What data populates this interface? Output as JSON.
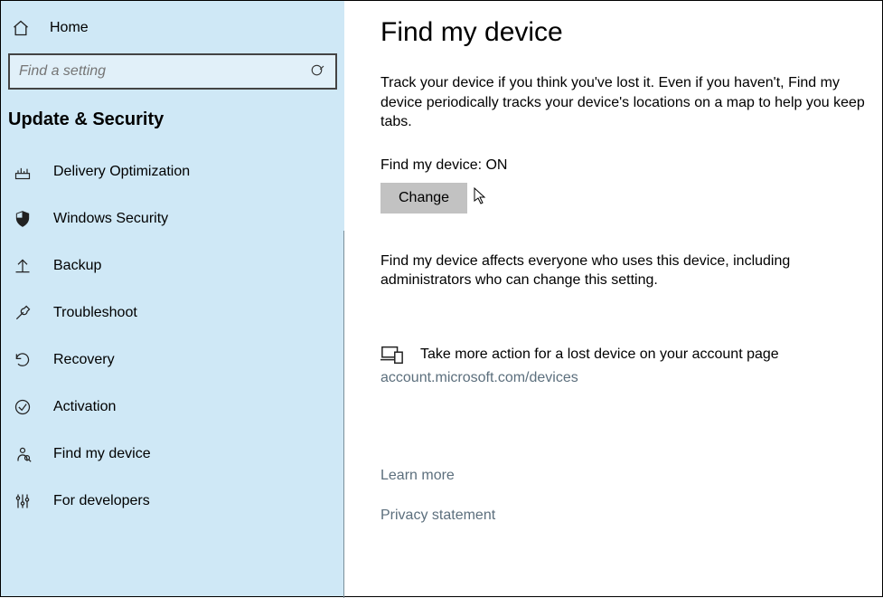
{
  "sidebar": {
    "home_label": "Home",
    "search_placeholder": "Find a setting",
    "category_heading": "Update & Security",
    "items": [
      {
        "label": "Delivery Optimization"
      },
      {
        "label": "Windows Security"
      },
      {
        "label": "Backup"
      },
      {
        "label": "Troubleshoot"
      },
      {
        "label": "Recovery"
      },
      {
        "label": "Activation"
      },
      {
        "label": "Find my device"
      },
      {
        "label": "For developers"
      }
    ]
  },
  "main": {
    "title": "Find my device",
    "intro": "Track your device if you think you've lost it. Even if you haven't, Find my device periodically tracks your device's locations on a map to help you keep tabs.",
    "status_label": "Find my device: ",
    "status_value": "ON",
    "change_label": "Change",
    "affects_text": "Find my device affects everyone who uses this device, including administrators who can change this setting.",
    "action_text": "Take more action for a lost device on your account page",
    "action_link": "account.microsoft.com/devices",
    "learn_more": "Learn more",
    "privacy": "Privacy statement"
  }
}
